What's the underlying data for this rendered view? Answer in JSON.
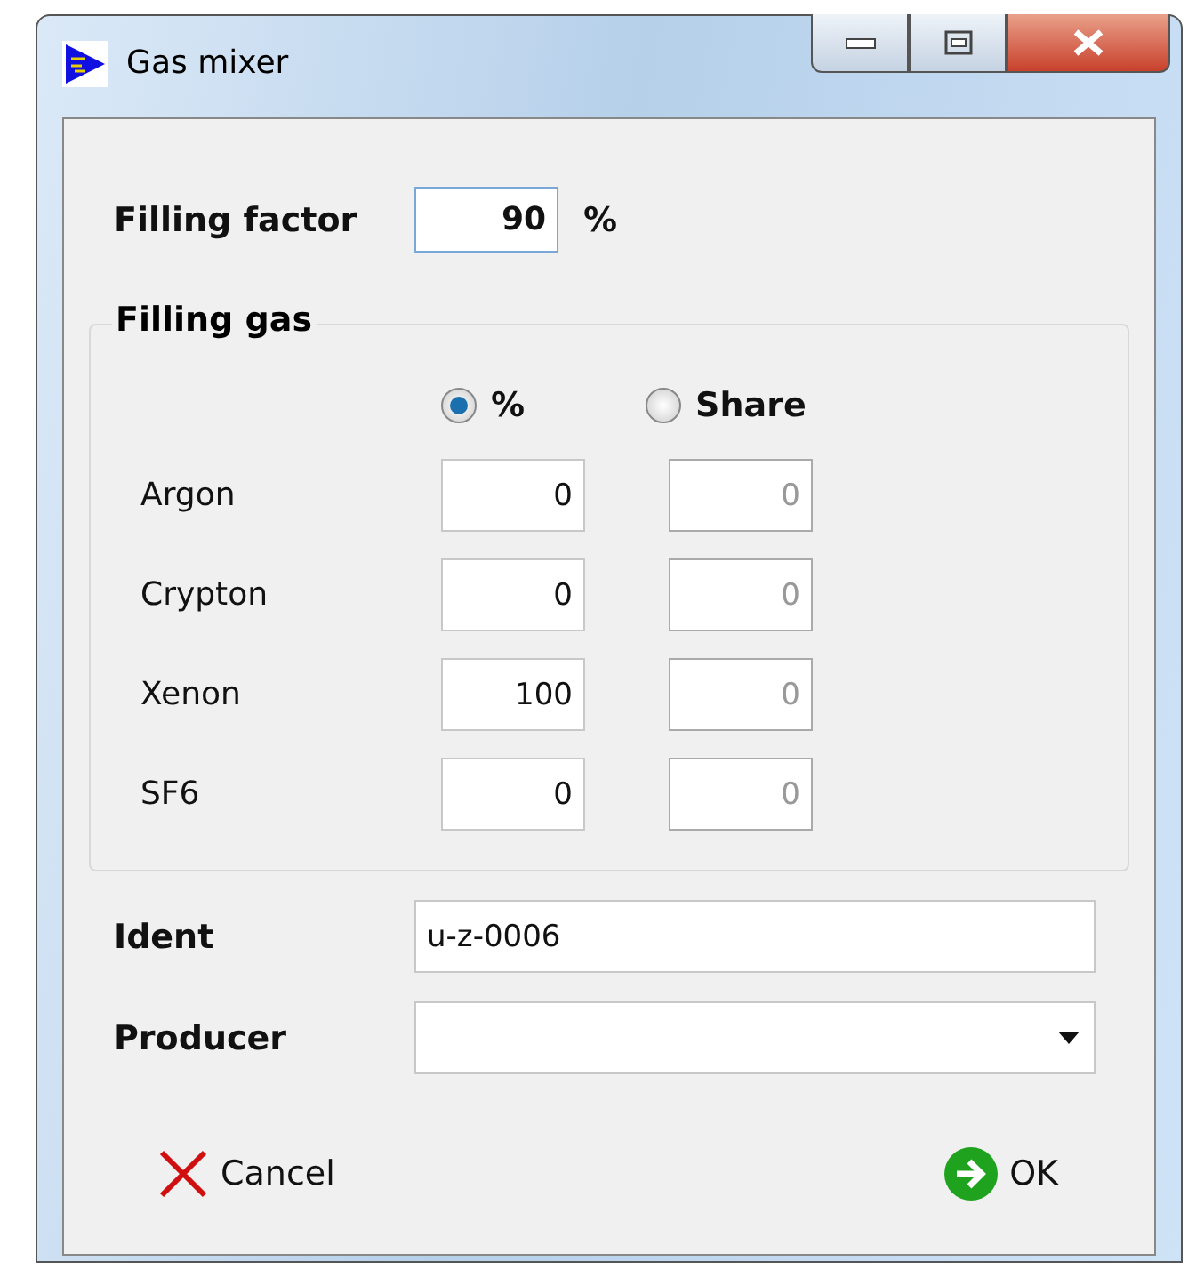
{
  "window": {
    "title": "Gas mixer"
  },
  "filling_factor": {
    "label": "Filling factor",
    "value": "90",
    "unit": "%"
  },
  "filling_gas": {
    "title": "Filling gas",
    "modes": [
      {
        "label": "%",
        "selected": true
      },
      {
        "label": "Share",
        "selected": false
      }
    ],
    "rows": [
      {
        "name": "Argon",
        "percent": "0",
        "share": "0"
      },
      {
        "name": "Crypton",
        "percent": "0",
        "share": "0"
      },
      {
        "name": "Xenon",
        "percent": "100",
        "share": "0"
      },
      {
        "name": "SF6",
        "percent": "0",
        "share": "0"
      }
    ]
  },
  "ident": {
    "label": "Ident",
    "value": "u-z-0006"
  },
  "producer": {
    "label": "Producer"
  },
  "buttons": [
    {
      "kind": "cancel",
      "label": "Cancel"
    },
    {
      "kind": "ok",
      "label": "OK"
    }
  ]
}
